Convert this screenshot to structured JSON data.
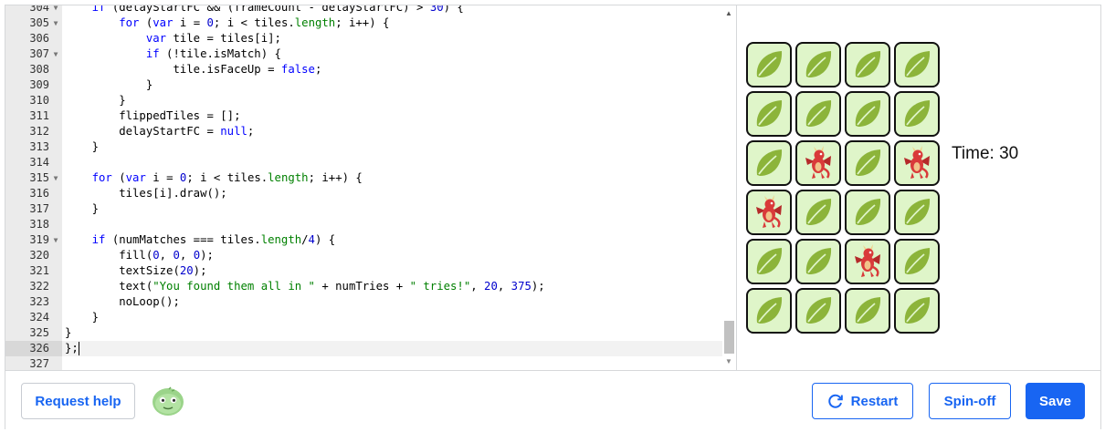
{
  "editor": {
    "lines": [
      {
        "n": "304",
        "fold": true,
        "html": "    <span class=\"kw\">if</span> (delayStartFC &amp;&amp; (frameCount - delayStartFC) &gt; <span class=\"num\">30</span>) {"
      },
      {
        "n": "305",
        "fold": true,
        "html": "        <span class=\"kw\">for</span> (<span class=\"kw\">var</span> i = <span class=\"num\">0</span>; i &lt; tiles.<span class=\"prop\">length</span>; i++) {"
      },
      {
        "n": "306",
        "fold": false,
        "html": "            <span class=\"kw\">var</span> tile = tiles[i];"
      },
      {
        "n": "307",
        "fold": true,
        "html": "            <span class=\"kw\">if</span> (!tile.isMatch) {"
      },
      {
        "n": "308",
        "fold": false,
        "html": "                tile.isFaceUp = <span class=\"kw\">false</span>;"
      },
      {
        "n": "309",
        "fold": false,
        "html": "            }"
      },
      {
        "n": "310",
        "fold": false,
        "html": "        }"
      },
      {
        "n": "311",
        "fold": false,
        "html": "        flippedTiles = [];"
      },
      {
        "n": "312",
        "fold": false,
        "html": "        delayStartFC = <span class=\"kw\">null</span>;"
      },
      {
        "n": "313",
        "fold": false,
        "html": "    }"
      },
      {
        "n": "314",
        "fold": false,
        "html": ""
      },
      {
        "n": "315",
        "fold": true,
        "html": "    <span class=\"kw\">for</span> (<span class=\"kw\">var</span> i = <span class=\"num\">0</span>; i &lt; tiles.<span class=\"prop\">length</span>; i++) {"
      },
      {
        "n": "316",
        "fold": false,
        "html": "        tiles[i].draw();"
      },
      {
        "n": "317",
        "fold": false,
        "html": "    }"
      },
      {
        "n": "318",
        "fold": false,
        "html": ""
      },
      {
        "n": "319",
        "fold": true,
        "html": "    <span class=\"kw\">if</span> (numMatches === tiles.<span class=\"prop\">length</span>/<span class=\"num\">4</span>) {"
      },
      {
        "n": "320",
        "fold": false,
        "html": "        fill(<span class=\"num\">0</span>, <span class=\"num\">0</span>, <span class=\"num\">0</span>);"
      },
      {
        "n": "321",
        "fold": false,
        "html": "        textSize(<span class=\"num\">20</span>);"
      },
      {
        "n": "322",
        "fold": false,
        "html": "        text(<span class=\"str\">\"You found them all in \"</span> + numTries + <span class=\"str\">\" tries!\"</span>, <span class=\"num\">20</span>, <span class=\"num\">375</span>);"
      },
      {
        "n": "323",
        "fold": false,
        "html": "        noLoop();"
      },
      {
        "n": "324",
        "fold": false,
        "html": "    }"
      },
      {
        "n": "325",
        "fold": false,
        "html": "}"
      },
      {
        "n": "326",
        "fold": false,
        "active": true,
        "html": "};<span class=\"cursor\"></span>"
      },
      {
        "n": "327",
        "fold": false,
        "html": ""
      }
    ]
  },
  "canvas": {
    "timer_text": "Time: 30",
    "tiles": [
      [
        "leaf",
        "leaf",
        "leaf",
        "leaf"
      ],
      [
        "leaf",
        "leaf",
        "leaf",
        "leaf"
      ],
      [
        "leaf",
        "dragon",
        "leaf",
        "dragon"
      ],
      [
        "dragon",
        "leaf",
        "leaf",
        "leaf"
      ],
      [
        "leaf",
        "leaf",
        "dragon",
        "leaf"
      ],
      [
        "leaf",
        "leaf",
        "leaf",
        "leaf"
      ]
    ],
    "colors": {
      "tile_bg": "#dff5c9",
      "leaf": "#8cb43a",
      "dragon": "#d93a3a"
    }
  },
  "footer": {
    "help_label": "Request help",
    "restart_label": "Restart",
    "spinoff_label": "Spin-off",
    "save_label": "Save",
    "avatar_icon": "green-blob-avatar-icon",
    "accent": "#1865f2"
  }
}
